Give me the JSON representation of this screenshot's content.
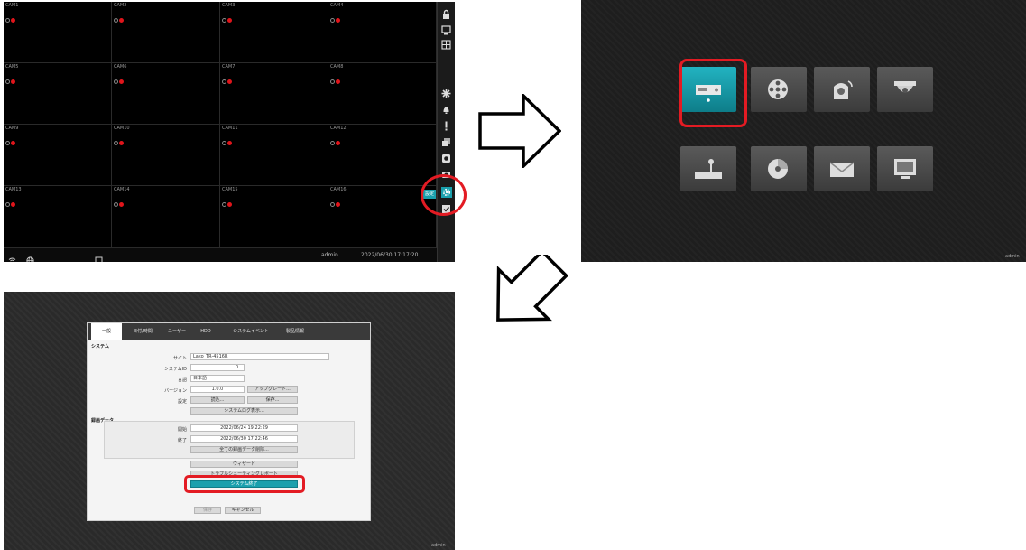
{
  "panel1": {
    "cameras": [
      "CAM1",
      "CAM2",
      "CAM3",
      "CAM4",
      "CAM5",
      "CAM6",
      "CAM7",
      "CAM8",
      "CAM9",
      "CAM10",
      "CAM11",
      "CAM12",
      "CAM13",
      "CAM14",
      "CAM15",
      "CAM16"
    ],
    "user": "admin",
    "datetime": "2022/06/30  17:17:20",
    "sidebar_label": "設定",
    "sidebar_icons": [
      "lock-icon",
      "monitor-icon",
      "layout-icon",
      "fan-icon",
      "bell-icon",
      "alert-icon",
      "camera-group-icon",
      "record-icon",
      "search-icon",
      "settings-icon",
      "checkbox-icon"
    ],
    "bottom_icons": [
      "wifi-icon",
      "globe-icon",
      "display-icon"
    ]
  },
  "panel2": {
    "menu_icons": [
      "system-settings-icon",
      "record-film-icon",
      "ptz-camera-icon",
      "dome-camera-icon",
      "keyboard-controller-icon",
      "disc-icon",
      "network-icon",
      "monitor-display-icon"
    ],
    "user": "admin"
  },
  "panel3": {
    "tabs": [
      "一般",
      "日付/時間",
      "ユーザー",
      "HDD",
      "システムイベント",
      "製品情報"
    ],
    "section_system": "システム",
    "site_label": "サイト",
    "site_value": "Lako_TR-4516R",
    "system_id_label": "システムID",
    "system_id_value": "0",
    "language_label": "言語",
    "language_value": "日本語",
    "version_label": "バージョン",
    "version_value": "1.0.0",
    "upgrade_button": "アップグレード...",
    "settings_label": "設定",
    "load_button": "読込...",
    "save_button": "保存...",
    "log_button": "システムログ表示...",
    "section_record": "録画データ",
    "start_label": "開始",
    "start_value": "2022/06/24  19:22:29",
    "end_label": "終了",
    "end_value": "2022/06/30  17:22:46",
    "delete_button": "全ての録画データ削除...",
    "wizard_button": "ウィザード",
    "troubleshoot_button": "トラブルシューティングレポート",
    "shutdown_button": "システム終了",
    "ok_button": "保存",
    "cancel_button": "キャンセル",
    "user": "admin"
  },
  "colors": {
    "highlight": "#e31b23",
    "accent": "#1aa0ad"
  }
}
